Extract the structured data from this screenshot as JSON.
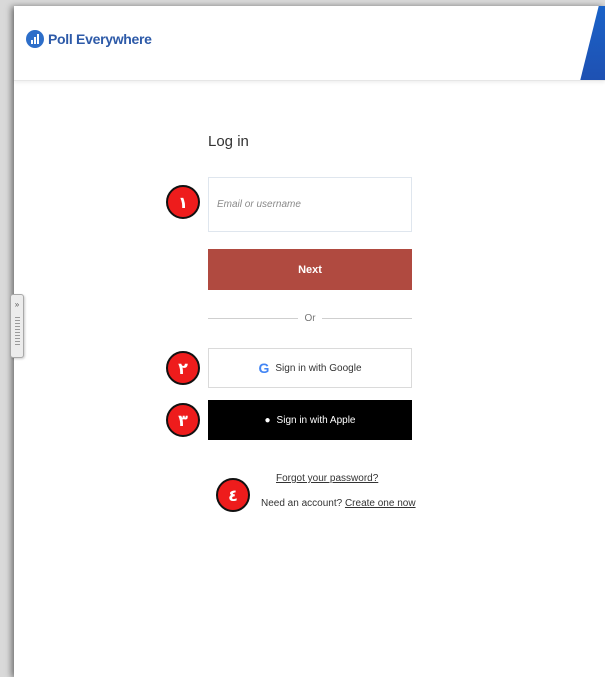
{
  "header": {
    "logo_text": "Poll Everywhere"
  },
  "side_handle": {
    "label": "»"
  },
  "login": {
    "title": "Log in",
    "email_placeholder": "Email or username",
    "next_label": "Next",
    "or_label": "Or",
    "google_label": "Sign in with Google",
    "apple_label": "Sign in with Apple",
    "forgot_label": "Forgot your password?",
    "need_account_text": "Need an account?",
    "create_label": "Create one now"
  },
  "annotations": [
    {
      "label": "١"
    },
    {
      "label": "٢"
    },
    {
      "label": "٣"
    },
    {
      "label": "٤"
    }
  ],
  "colors": {
    "next_button": "#b04a40",
    "apple_button": "#000000",
    "logo": "#2d6ec9",
    "marker": "#ee1c1c"
  }
}
